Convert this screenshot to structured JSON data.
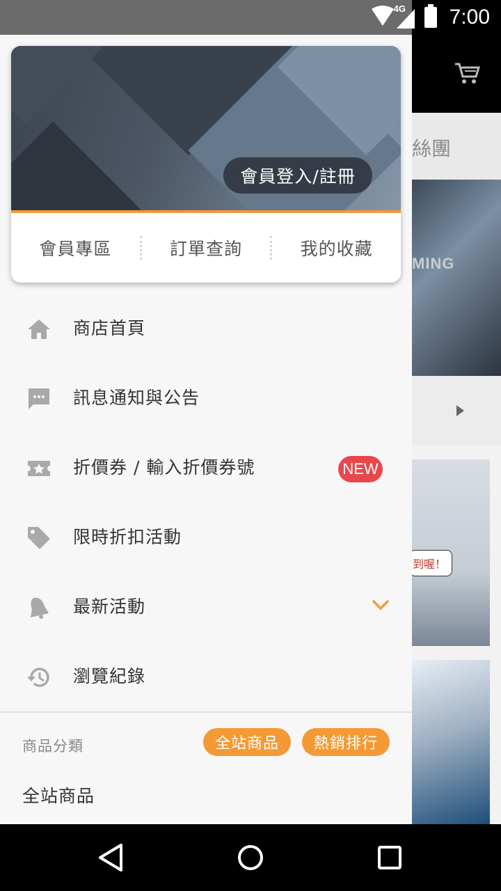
{
  "status_bar": {
    "network": "4G",
    "time": "7:00"
  },
  "background": {
    "tab_fragment": "絲團",
    "banner_fragment": "MING",
    "badge_fragment": "到喔！"
  },
  "profile": {
    "login_label": "會員登入/註冊",
    "quick_links": [
      "會員專區",
      "訂單查詢",
      "我的收藏"
    ]
  },
  "menu": {
    "items": [
      {
        "label": "商店首頁",
        "icon": "home-icon"
      },
      {
        "label": "訊息通知與公告",
        "icon": "chat-icon"
      },
      {
        "label": "折價券 / 輸入折價券號",
        "icon": "ticket-icon",
        "badge": "NEW"
      },
      {
        "label": "限時折扣活動",
        "icon": "tag-icon"
      },
      {
        "label": "最新活動",
        "icon": "bell-icon"
      },
      {
        "label": "瀏覽紀錄",
        "icon": "history-icon"
      }
    ]
  },
  "category": {
    "header": "商品分類",
    "pills": [
      "全站商品",
      "熱銷排行"
    ],
    "first_item": "全站商品"
  },
  "colors": {
    "accent": "#f39a36",
    "badge_red": "#e8474c",
    "icon_grey": "#a9a9a9"
  }
}
